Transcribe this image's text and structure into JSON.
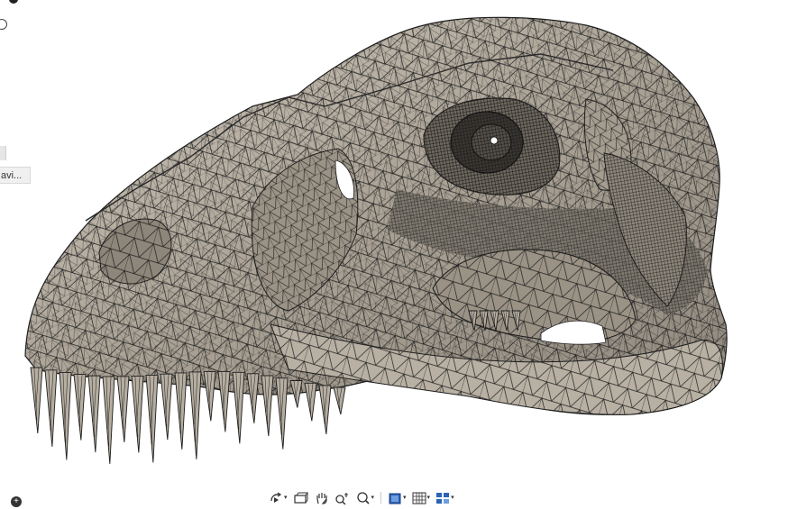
{
  "left_panel": {
    "collapsed_label": "avi..."
  },
  "bottom_toolbar": {
    "tools": [
      {
        "icon": "orbit-icon",
        "has_menu": true
      },
      {
        "icon": "look-at-icon",
        "has_menu": false
      },
      {
        "icon": "pan-hand-icon",
        "has_menu": false
      },
      {
        "icon": "zoom-icon",
        "has_menu": false
      },
      {
        "icon": "fit-zoom-icon",
        "has_menu": true
      },
      {
        "icon": "display-style-icon",
        "has_menu": true
      },
      {
        "icon": "grid-icon",
        "has_menu": true
      },
      {
        "icon": "viewports-icon",
        "has_menu": true
      }
    ],
    "menu_caret": "▾",
    "add_symbol": "+"
  },
  "model": {
    "subject": "dinosaur-skull-mesh",
    "colors": {
      "mesh_fill": "#b5ada0",
      "mesh_fill_dark": "#8e877c",
      "mesh_fill_light": "#d8d2c6",
      "wire": "#1e1e1e",
      "background": "#ffffff"
    }
  }
}
